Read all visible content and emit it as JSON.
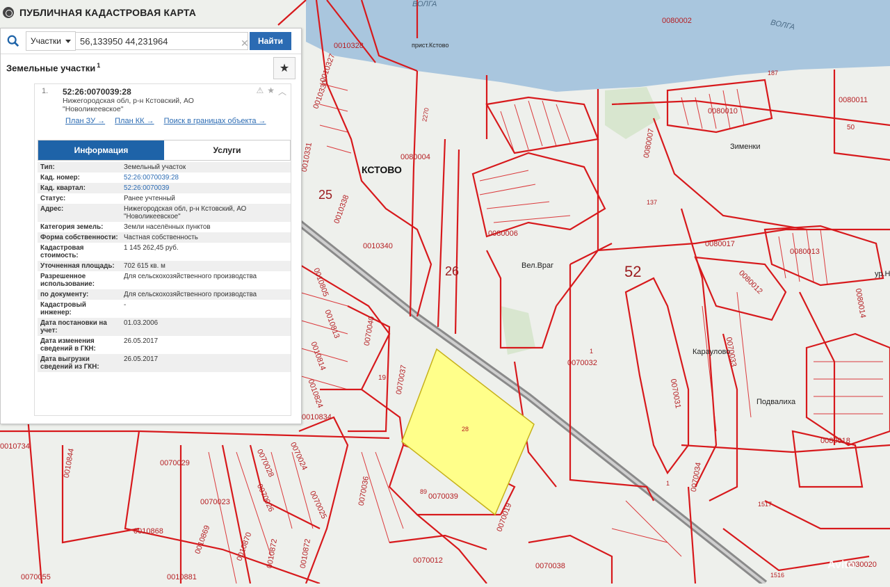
{
  "header": {
    "title": "ПУБЛИЧНАЯ КАДАСТРОВАЯ КАРТА"
  },
  "search": {
    "type_label": "Участки",
    "value": "56,133950 44,231964",
    "find_label": "Найти"
  },
  "section": {
    "title": "Земельные участки",
    "sup": "1"
  },
  "result": {
    "num": "1.",
    "id": "52:26:0070039:28",
    "address": "Нижегородская обл, р-н Кстовский, АО \"Новоликеевское\"",
    "links": [
      "План ЗУ →",
      "План КК →",
      "Поиск в границах объекта →"
    ]
  },
  "tabs": {
    "info": "Информация",
    "services": "Услуги"
  },
  "info_rows": [
    {
      "k": "Тип:",
      "v": "Земельный участок"
    },
    {
      "k": "Кад. номер:",
      "v": "52:26:0070039:28",
      "link": true
    },
    {
      "k": "Кад. квартал:",
      "v": "52:26:0070039",
      "link": true
    },
    {
      "k": "Статус:",
      "v": "Ранее учтенный"
    },
    {
      "k": "Адрес:",
      "v": "Нижегородская обл, р-н Кстовский, АО \"Новоликеевское\""
    },
    {
      "k": "Категория земель:",
      "v": "Земли населённых пунктов"
    },
    {
      "k": "Форма собственности:",
      "v": "Частная собственность"
    },
    {
      "k": "Кадастровая стоимость:",
      "v": "1 145 262,45 руб."
    },
    {
      "k": "Уточненная площадь:",
      "v": "702 615 кв. м"
    },
    {
      "k": "Разрешенное использование:",
      "v": "Для сельскохозяйственного производства"
    },
    {
      "k": "по документу:",
      "v": "Для сельскохозяйственного производства"
    },
    {
      "k": "Кадастровый инженер:",
      "v": "-"
    },
    {
      "k": "Дата постановки на учет:",
      "v": "01.03.2006"
    },
    {
      "k": "Дата изменения сведений в ГКН:",
      "v": "26.05.2017"
    },
    {
      "k": "Дата выгрузки сведений из ГКН:",
      "v": "26.05.2017"
    }
  ],
  "map_labels": {
    "volga1": "ВОЛГА",
    "volga2": "ВОЛГА",
    "pristan": "прист.Кстово",
    "kstovo": "КСТОВО",
    "zimenki": "Зименки",
    "velvrag": "Вел.Враг",
    "karaulovo": "Караулово",
    "podvalikha": "Подвалиха",
    "q52": "52",
    "q25": "25",
    "q26": "26",
    "parcel28": "28",
    "b0080002": "0080002",
    "b0010328": "0010328",
    "b0010327": "0010327",
    "b0010330": "0010330",
    "b0010331": "0010331",
    "b0010338": "0010338",
    "b0010340": "0010340",
    "b0080004": "0080004",
    "b0080006": "0080006",
    "b0080007": "0080007",
    "b0080010": "0080010",
    "b0080011": "0080011",
    "b0080017": "0080017",
    "b0080013": "0080013",
    "b0080012": "0080012",
    "b0080014": "0080014",
    "b0080018": "0080018",
    "b0070032": "0070032",
    "b0070031": "0070031",
    "b0070033": "0070033",
    "b0070034": "0070034",
    "b0070037": "0070037",
    "b0070040": "0070040",
    "b0070039": "0070039",
    "b0070019": "0070019",
    "b0070038": "0070038",
    "b0070036": "0070036",
    "b0070029": "0070029",
    "b0070028": "0070028",
    "b0070024": "0070024",
    "b0070023": "0070023",
    "b0070026": "0070026",
    "b0070025": "0070025",
    "b0070012": "0070012",
    "b0010805": "0010805",
    "b0010813": "0010813",
    "b0010814": "0010814",
    "b0010824": "0010824",
    "b0010834": "0010834",
    "b0010844": "0010844",
    "b0010868": "0010868",
    "b0010869": "0010869",
    "b0010870": "0010870",
    "b0010872": "0010872",
    "b0010873": "0010872",
    "b0010881": "0010881",
    "b0070055": "0070055",
    "b0010734": "0010734",
    "b0030020": "0030020",
    "n1517": "1517",
    "n1516": "1516",
    "n2270": "2270",
    "n187": "187",
    "n137": "137",
    "n19": "19",
    "n89": "89",
    "n50": "50",
    "n1": "1",
    "n1b": "1",
    "ur": "ур.Н",
    "avito": "Avito"
  },
  "colors": {
    "boundary": "#d7191c",
    "water": "#a9c6de",
    "parcel_fill": "#ffff8a",
    "panel_accent": "#2b6bb3"
  }
}
